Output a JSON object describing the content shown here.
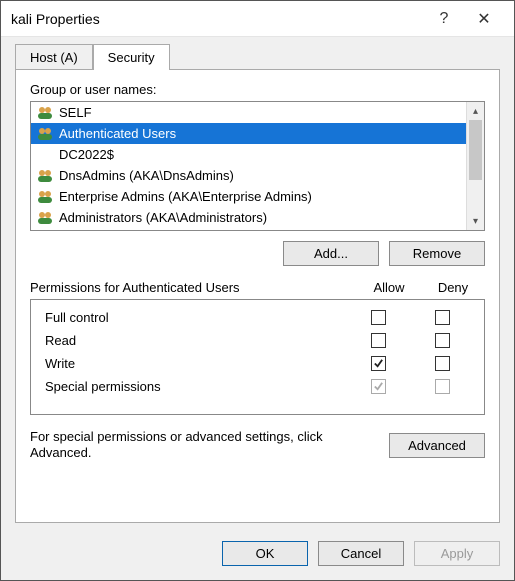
{
  "window": {
    "title": "kali Properties",
    "help": "?",
    "close": "✕"
  },
  "tabs": [
    {
      "label": "Host (A)",
      "active": false
    },
    {
      "label": "Security",
      "active": true
    }
  ],
  "groupLabel": "Group or user names:",
  "principals": [
    {
      "name": "SELF",
      "icon": "group",
      "selected": false
    },
    {
      "name": "Authenticated Users",
      "icon": "group",
      "selected": true
    },
    {
      "name": "DC2022$",
      "icon": "none",
      "selected": false
    },
    {
      "name": "DnsAdmins (AKA\\DnsAdmins)",
      "icon": "group",
      "selected": false
    },
    {
      "name": "Enterprise Admins (AKA\\Enterprise Admins)",
      "icon": "group",
      "selected": false
    },
    {
      "name": "Administrators (AKA\\Administrators)",
      "icon": "group",
      "selected": false
    }
  ],
  "buttons": {
    "add": "Add...",
    "remove": "Remove",
    "advanced": "Advanced",
    "ok": "OK",
    "cancel": "Cancel",
    "apply": "Apply"
  },
  "permHeader": {
    "title": "Permissions for Authenticated Users",
    "allow": "Allow",
    "deny": "Deny"
  },
  "permissions": [
    {
      "name": "Full control",
      "allow": false,
      "deny": false,
      "disabled": false
    },
    {
      "name": "Read",
      "allow": false,
      "deny": false,
      "disabled": false
    },
    {
      "name": "Write",
      "allow": true,
      "deny": false,
      "disabled": false
    },
    {
      "name": "Special permissions",
      "allow": true,
      "deny": false,
      "disabled": true
    }
  ],
  "advText": "For special permissions or advanced settings, click Advanced."
}
